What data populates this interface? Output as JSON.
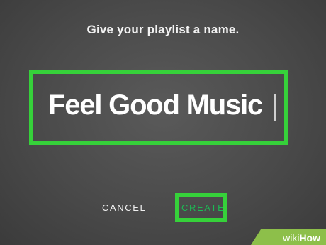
{
  "dialog": {
    "prompt": "Give your playlist a name.",
    "playlist_name": "Feel Good Music"
  },
  "actions": {
    "cancel_label": "CANCEL",
    "create_label": "CREATE"
  },
  "watermark": {
    "wiki": "wiki",
    "how": "How"
  },
  "colors": {
    "background": "#4a4a4a",
    "highlight": "#36d13a",
    "accent": "#1db954",
    "watermark": "#8dbf4a"
  }
}
